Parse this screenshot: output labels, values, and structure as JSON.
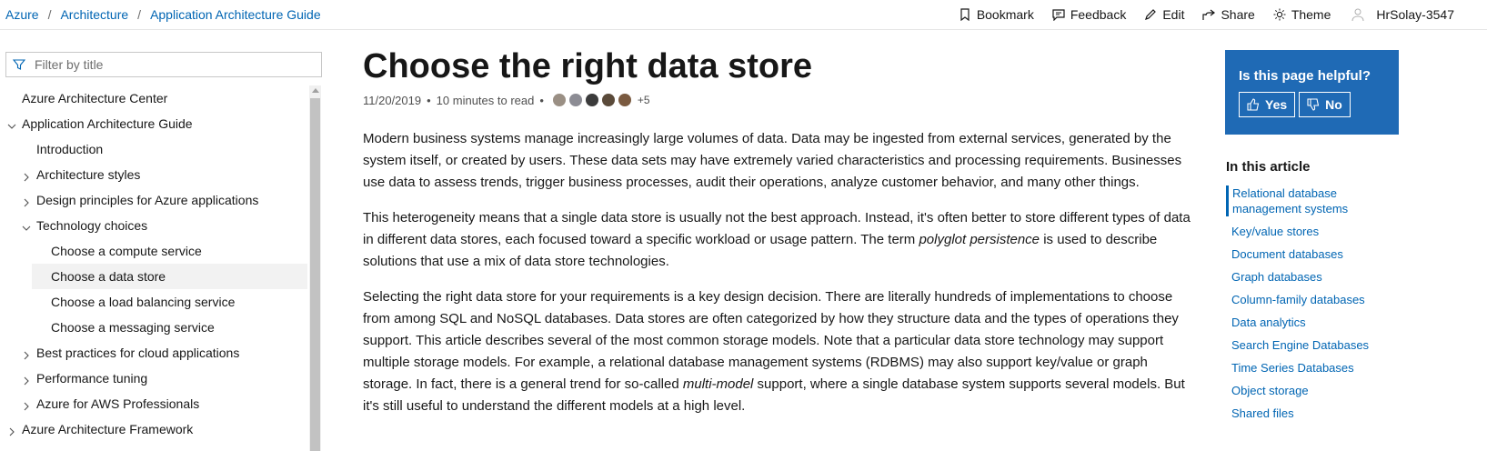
{
  "breadcrumb": [
    "Azure",
    "Architecture",
    "Application Architecture Guide"
  ],
  "breadcrumb_separator": "/",
  "actions": {
    "bookmark": "Bookmark",
    "feedback": "Feedback",
    "edit": "Edit",
    "share": "Share",
    "theme": "Theme",
    "user": "HrSolay-3547"
  },
  "filter": {
    "placeholder": "Filter by title"
  },
  "toc": [
    {
      "label": "Azure Architecture Center",
      "level": 0,
      "chevron": "none"
    },
    {
      "label": "Application Architecture Guide",
      "level": 0,
      "chevron": "down"
    },
    {
      "label": "Introduction",
      "level": 1,
      "chevron": "none"
    },
    {
      "label": "Architecture styles",
      "level": 1,
      "chevron": "right"
    },
    {
      "label": "Design principles for Azure applications",
      "level": 1,
      "chevron": "right"
    },
    {
      "label": "Technology choices",
      "level": 1,
      "chevron": "down"
    },
    {
      "label": "Choose a compute service",
      "level": 2,
      "chevron": "none"
    },
    {
      "label": "Choose a data store",
      "level": 2,
      "chevron": "none",
      "active": true
    },
    {
      "label": "Choose a load balancing service",
      "level": 2,
      "chevron": "none"
    },
    {
      "label": "Choose a messaging service",
      "level": 2,
      "chevron": "none"
    },
    {
      "label": "Best practices for cloud applications",
      "level": 1,
      "chevron": "right"
    },
    {
      "label": "Performance tuning",
      "level": 1,
      "chevron": "right"
    },
    {
      "label": "Azure for AWS Professionals",
      "level": 1,
      "chevron": "right"
    },
    {
      "label": "Azure Architecture Framework",
      "level": 0,
      "chevron": "right"
    }
  ],
  "article": {
    "title": "Choose the right data store",
    "date": "11/20/2019",
    "read_time": "10 minutes to read",
    "contributors_more": "+5",
    "p1": "Modern business systems manage increasingly large volumes of data. Data may be ingested from external services, generated by the system itself, or created by users. These data sets may have extremely varied characteristics and processing requirements. Businesses use data to assess trends, trigger business processes, audit their operations, analyze customer behavior, and many other things.",
    "p2_before": "This heterogeneity means that a single data store is usually not the best approach. Instead, it's often better to store different types of data in different data stores, each focused toward a specific workload or usage pattern. The term ",
    "p2_em": "polyglot persistence",
    "p2_after": " is used to describe solutions that use a mix of data store technologies.",
    "p3_before": "Selecting the right data store for your requirements is a key design decision. There are literally hundreds of implementations to choose from among SQL and NoSQL databases. Data stores are often categorized by how they structure data and the types of operations they support. This article describes several of the most common storage models. Note that a particular data store technology may support multiple storage models. For example, a relational database management systems (RDBMS) may also support key/value or graph storage. In fact, there is a general trend for so-called ",
    "p3_em": "multi-model",
    "p3_after": " support, where a single database system supports several models. But it's still useful to understand the different models at a high level."
  },
  "helpful": {
    "question": "Is this page helpful?",
    "yes": "Yes",
    "no": "No"
  },
  "in_this_article": {
    "title": "In this article",
    "items": [
      "Relational database management systems",
      "Key/value stores",
      "Document databases",
      "Graph databases",
      "Column-family databases",
      "Data analytics",
      "Search Engine Databases",
      "Time Series Databases",
      "Object storage",
      "Shared files"
    ]
  },
  "colors": {
    "link": "#0065b3",
    "helpful_bg": "#1f6ab5",
    "active_bg": "#f2f2f2"
  }
}
